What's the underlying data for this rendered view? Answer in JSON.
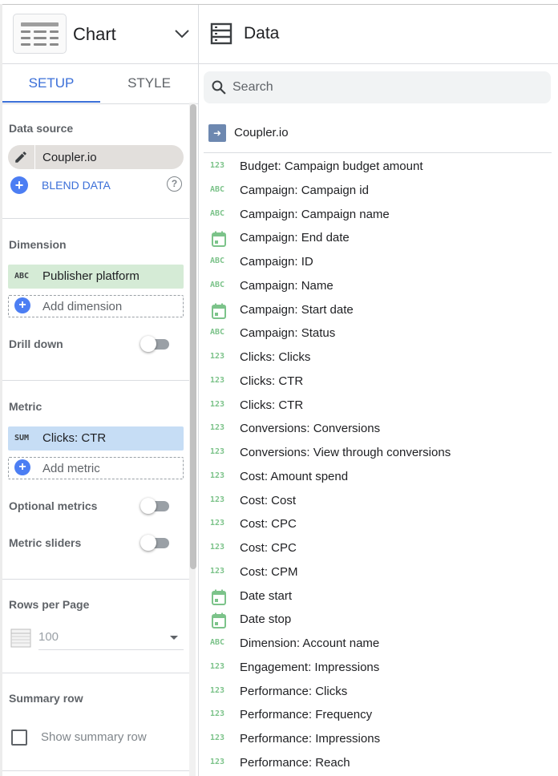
{
  "chart_panel": {
    "title": "Chart",
    "tabs": [
      {
        "label": "SETUP",
        "active": true
      },
      {
        "label": "STYLE",
        "active": false
      }
    ]
  },
  "setup": {
    "data_source": {
      "section_label": "Data source",
      "source_name": "Coupler.io",
      "blend_label": "BLEND DATA",
      "help_glyph": "?"
    },
    "dimension": {
      "section_label": "Dimension",
      "chip_type": "ABC",
      "chip_label": "Publisher platform",
      "chip_color": "#d5ebd6",
      "add_label": "Add dimension",
      "drill_down_label": "Drill down"
    },
    "metric": {
      "section_label": "Metric",
      "chip_type": "SUM",
      "chip_label": "Clicks: CTR",
      "chip_color": "#c6ddf5",
      "add_label": "Add metric",
      "optional_metrics_label": "Optional metrics",
      "metric_sliders_label": "Metric sliders"
    },
    "rows_per_page": {
      "section_label": "Rows per Page",
      "value": "100"
    },
    "summary_row": {
      "section_label": "Summary row",
      "checkbox_label": "Show summary row"
    }
  },
  "data_panel": {
    "title": "Data",
    "search_placeholder": "Search",
    "source_name": "Coupler.io",
    "fields": [
      {
        "type": "123",
        "name": "Budget: Campaign budget amount"
      },
      {
        "type": "ABC",
        "name": "Campaign: Campaign id"
      },
      {
        "type": "ABC",
        "name": "Campaign: Campaign name"
      },
      {
        "type": "date",
        "name": "Campaign: End date"
      },
      {
        "type": "ABC",
        "name": "Campaign: ID"
      },
      {
        "type": "ABC",
        "name": "Campaign: Name"
      },
      {
        "type": "date",
        "name": "Campaign: Start date"
      },
      {
        "type": "ABC",
        "name": "Campaign: Status"
      },
      {
        "type": "123",
        "name": "Clicks: Clicks"
      },
      {
        "type": "123",
        "name": "Clicks: CTR"
      },
      {
        "type": "123",
        "name": "Clicks: CTR"
      },
      {
        "type": "123",
        "name": "Conversions: Conversions"
      },
      {
        "type": "123",
        "name": "Conversions: View through conversions"
      },
      {
        "type": "123",
        "name": "Cost: Amount spend"
      },
      {
        "type": "123",
        "name": "Cost: Cost"
      },
      {
        "type": "123",
        "name": "Cost: CPC"
      },
      {
        "type": "123",
        "name": "Cost: CPC"
      },
      {
        "type": "123",
        "name": "Cost: CPM"
      },
      {
        "type": "date",
        "name": "Date start"
      },
      {
        "type": "date",
        "name": "Date stop"
      },
      {
        "type": "ABC",
        "name": "Dimension: Account name"
      },
      {
        "type": "123",
        "name": "Engagement: Impressions"
      },
      {
        "type": "123",
        "name": "Performance: Clicks"
      },
      {
        "type": "123",
        "name": "Performance: Frequency"
      },
      {
        "type": "123",
        "name": "Performance: Impressions"
      },
      {
        "type": "123",
        "name": "Performance: Reach"
      }
    ]
  },
  "colors": {
    "accent": "#3b6fd8",
    "field_type": "#7cc38a",
    "dimension_chip": "#d5ebd6",
    "metric_chip": "#c6ddf5"
  }
}
